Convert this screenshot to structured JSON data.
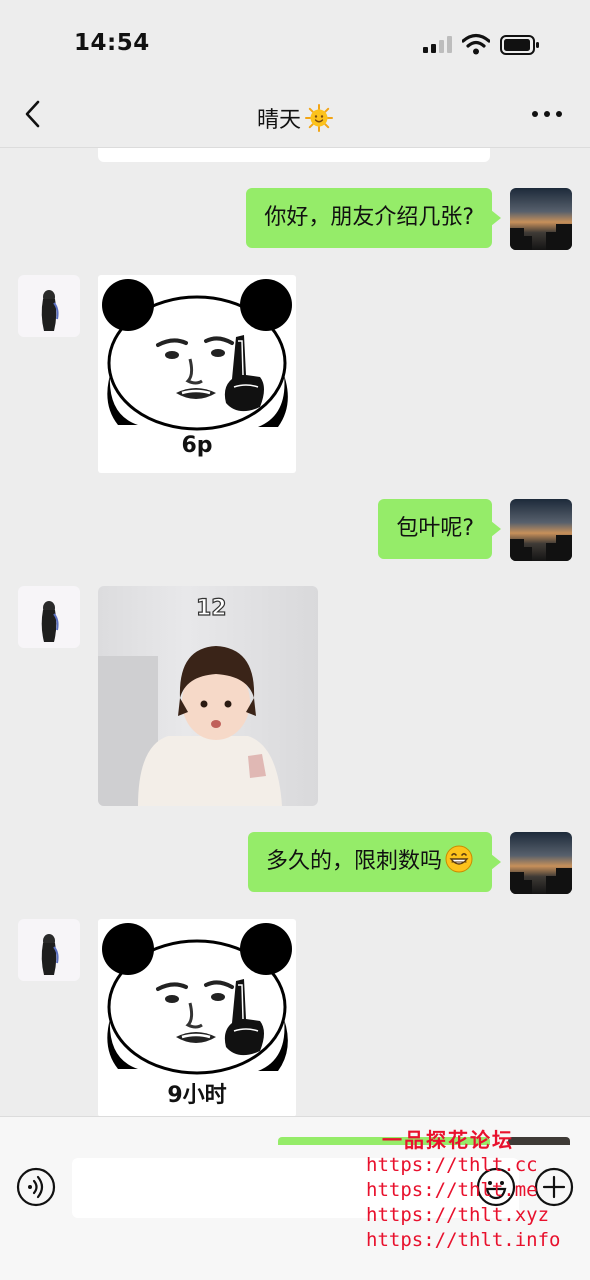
{
  "status_bar": {
    "time": "14:54"
  },
  "nav": {
    "title": "晴天",
    "title_icon": "sun-emoji-icon",
    "back_icon": "chevron-left-icon",
    "more_icon": "more-dots-icon"
  },
  "messages": [
    {
      "side": "right",
      "type": "text",
      "text": "你好，朋友介绍几张?"
    },
    {
      "side": "left",
      "type": "sticker",
      "sticker": "panda-face-pointing",
      "caption": "6p"
    },
    {
      "side": "right",
      "type": "text",
      "text": "包叶呢?"
    },
    {
      "side": "left",
      "type": "photo",
      "description_tag": "12"
    },
    {
      "side": "right",
      "type": "text",
      "text": "多久的，限刺数吗",
      "trailing_icon": "grinning-emoji-icon"
    },
    {
      "side": "left",
      "type": "sticker",
      "sticker": "panda-face-pointing",
      "caption": "9小时"
    }
  ],
  "input_bar": {
    "value": "",
    "voice_icon": "voice-icon",
    "emoji_icon": "emoji-icon",
    "plus_icon": "plus-icon"
  },
  "watermark": {
    "title": "一品探花论坛",
    "lines": [
      "https://thlt.cc",
      "https://thlt.me",
      "https://thlt.xyz",
      "https://thlt.info"
    ]
  },
  "colors": {
    "background": "#ededed",
    "bubble_green": "#95ec69",
    "watermark_red": "#e8112d"
  }
}
